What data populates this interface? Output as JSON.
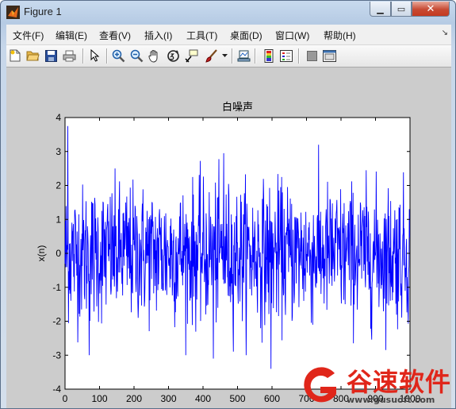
{
  "window": {
    "title": "Figure 1"
  },
  "menu": {
    "items": [
      "文件(F)",
      "编辑(E)",
      "查看(V)",
      "插入(I)",
      "工具(T)",
      "桌面(D)",
      "窗口(W)",
      "帮助(H)"
    ]
  },
  "toolbar": {
    "icons": [
      "new-figure-icon",
      "open-file-icon",
      "save-icon",
      "print-icon",
      "arrow-pointer-icon",
      "zoom-in-icon",
      "zoom-out-icon",
      "pan-hand-icon",
      "rotate-3d-icon",
      "data-cursor-icon",
      "brush-icon",
      "link-plot-icon",
      "colorbar-icon",
      "legend-icon",
      "hide-plot-tools-icon",
      "show-plot-tools-icon"
    ]
  },
  "chart_data": {
    "type": "line",
    "title": "白噪声",
    "xlabel": "n",
    "ylabel": "x(n)",
    "xlim": [
      0,
      1000
    ],
    "ylim": [
      -4,
      4
    ],
    "xticks": [
      0,
      100,
      200,
      300,
      400,
      500,
      600,
      700,
      800,
      900,
      1000
    ],
    "yticks": [
      -4,
      -3,
      -2,
      -1,
      0,
      1,
      2,
      3,
      4
    ],
    "series": [
      {
        "color": "#0000ff",
        "n_points": 1000,
        "distribution": "gaussian",
        "mean": 0,
        "std": 1,
        "notable_points": [
          {
            "x": 8,
            "y": 3.75
          },
          {
            "x": 70,
            "y": -3.0
          },
          {
            "x": 430,
            "y": -3.1
          },
          {
            "x": 460,
            "y": 2.95
          },
          {
            "x": 597,
            "y": -3.4
          }
        ]
      }
    ],
    "grid": false
  },
  "watermark": {
    "text": "谷速软件",
    "url": "www.gusuoft.com"
  }
}
